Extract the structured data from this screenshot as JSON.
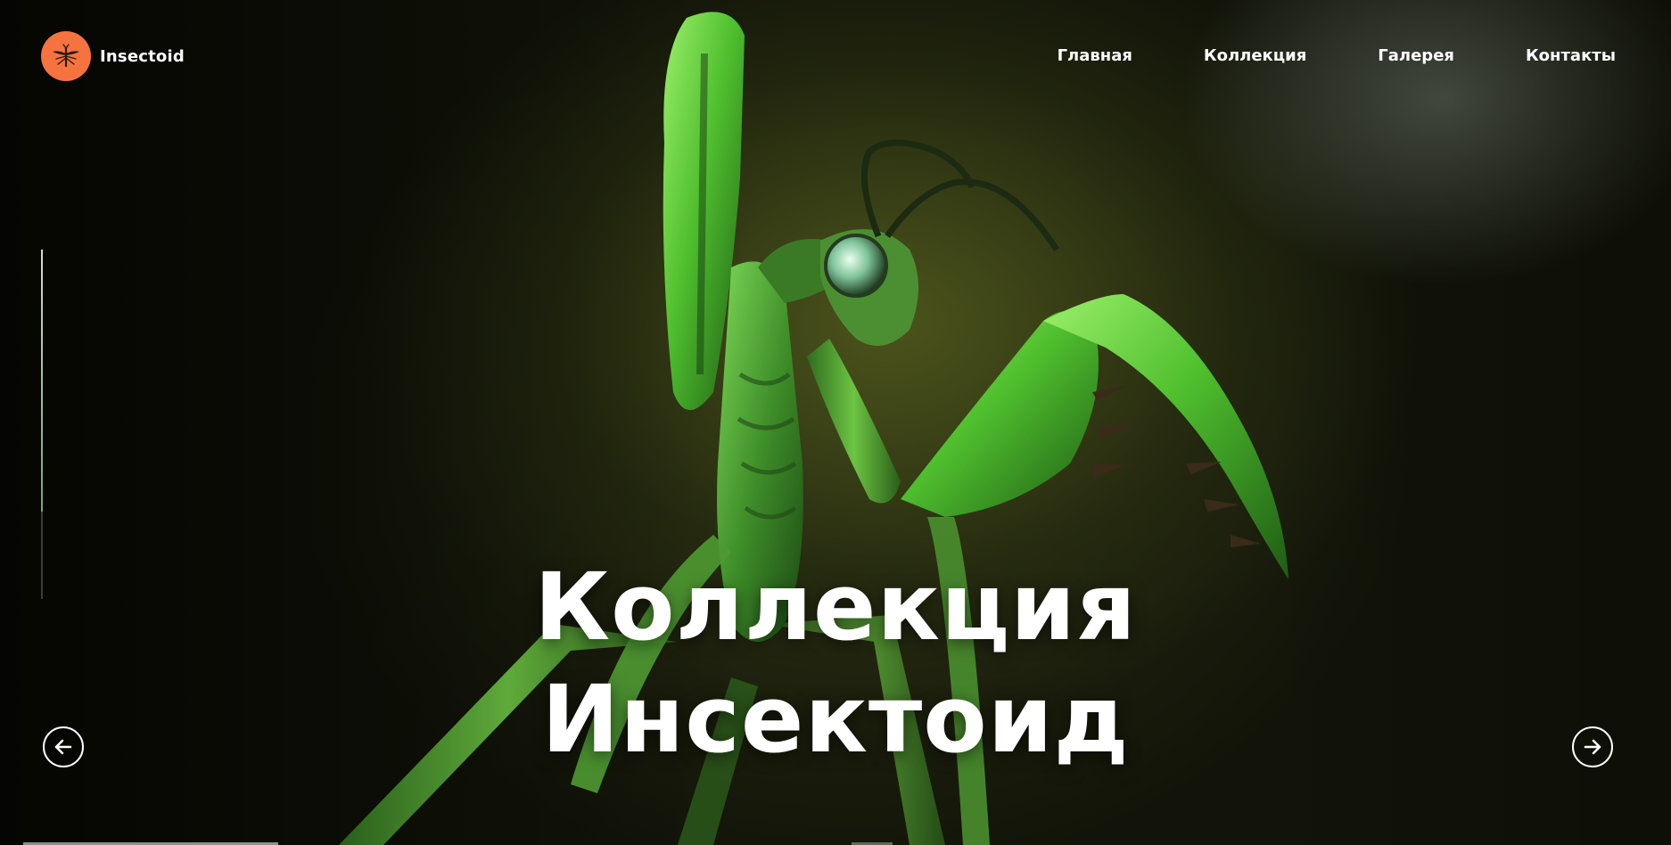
{
  "brand": {
    "name": "Insectoid",
    "logo_color": "#f6733f",
    "logo_icon": "mosquito-icon"
  },
  "nav": {
    "items": [
      {
        "label": "Главная"
      },
      {
        "label": "Коллекция"
      },
      {
        "label": "Галерея"
      },
      {
        "label": "Контакты"
      }
    ]
  },
  "hero": {
    "title_line1": "Коллекция",
    "title_line2": "Инсектоид",
    "background_image": "green-praying-mantis-render"
  },
  "slider": {
    "prev_icon": "arrow-left-icon",
    "next_icon": "arrow-right-icon",
    "progress": 0.75,
    "slides_count": 3,
    "active_slide": 1
  }
}
